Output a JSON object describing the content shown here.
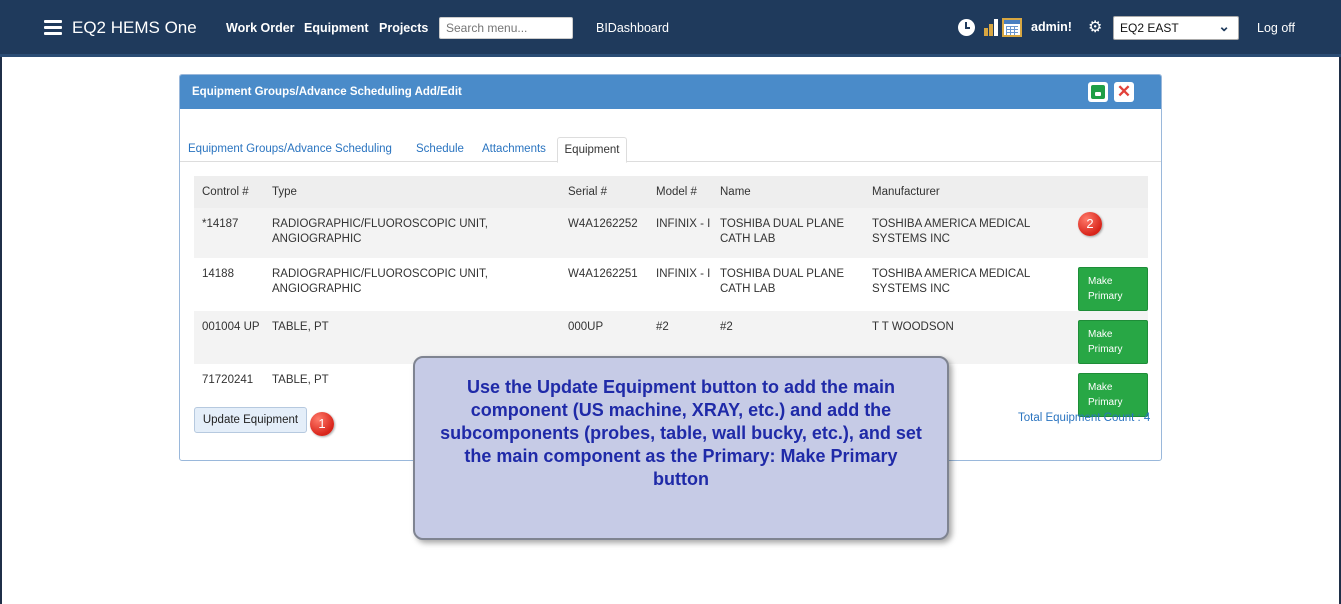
{
  "navbar": {
    "brand": "EQ2 HEMS One",
    "links": [
      "Work Order",
      "Equipment",
      "Projects"
    ],
    "search_placeholder": "Search menu...",
    "bidashboard": "BIDashboard",
    "user": "admin!",
    "region": "EQ2 EAST",
    "logoff": "Log off",
    "colors": {
      "bg": "#1f3a5c"
    }
  },
  "panel": {
    "title": "Equipment Groups/Advance Scheduling Add/Edit",
    "tabs": [
      "Equipment Groups/Advance Scheduling",
      "Schedule",
      "Attachments"
    ],
    "active_tab": "Equipment",
    "header_color": "#4a8bc9"
  },
  "table": {
    "headers": [
      "Control #",
      "Type",
      "Serial #",
      "Model #",
      "Name",
      "Manufacturer"
    ],
    "rows": [
      {
        "control": "*14187",
        "type": "RADIOGRAPHIC/FLUOROSCOPIC UNIT, ANGIOGRAPHIC",
        "serial": "W4A1262252",
        "model": "INFINIX - I",
        "name": "TOSHIBA DUAL PLANE CATH LAB",
        "manufacturer": "TOSHIBA AMERICA MEDICAL SYSTEMS INC",
        "action": ""
      },
      {
        "control": "14188",
        "type": "RADIOGRAPHIC/FLUOROSCOPIC UNIT, ANGIOGRAPHIC",
        "serial": "W4A1262251",
        "model": "INFINIX - I",
        "name": "TOSHIBA DUAL PLANE CATH LAB",
        "manufacturer": "TOSHIBA AMERICA MEDICAL SYSTEMS INC",
        "action": "Make Primary"
      },
      {
        "control": "001004 UP",
        "type": "TABLE, PT",
        "serial": "000UP",
        "model": "#2",
        "name": "#2",
        "manufacturer": "T T WOODSON",
        "action": "Make Primary"
      },
      {
        "control": "71720241",
        "type": "TABLE, PT",
        "serial": "",
        "model": "",
        "name": "",
        "manufacturer": "",
        "action": "Make Primary"
      }
    ]
  },
  "footer": {
    "update_button": "Update Equipment",
    "total": "Total Equipment Count : 4"
  },
  "callouts": {
    "one": "1",
    "two": "2"
  },
  "note": "Use the Update Equipment button to add the main component (US machine, XRAY, etc.) and add the subcomponents (probes, table, wall bucky, etc.), and set the main component as the Primary: Make Primary button",
  "colors": {
    "primary_btn": "#28a745",
    "link": "#2a74c0",
    "callout": "#d8241a"
  }
}
